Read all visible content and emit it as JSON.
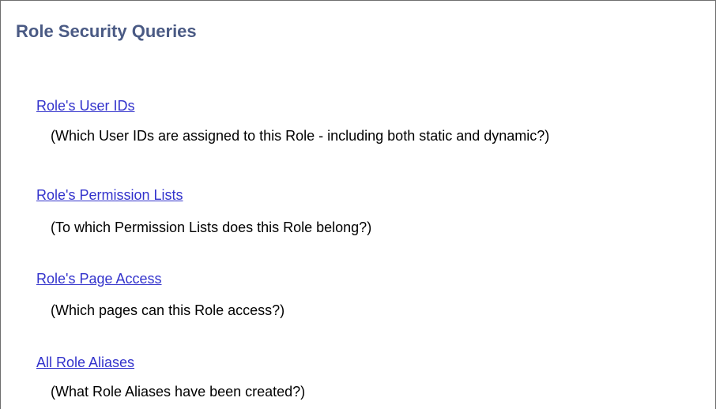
{
  "page": {
    "title": "Role Security Queries"
  },
  "queries": [
    {
      "link": "Role's User IDs",
      "description": "(Which User IDs are assigned to this Role - including both static and dynamic?)"
    },
    {
      "link": "Role's Permission Lists",
      "description": "(To which Permission Lists does this Role belong?)"
    },
    {
      "link": "Role's Page Access",
      "description": "(Which pages can this Role access?)"
    },
    {
      "link": "All Role Aliases",
      "description": "(What Role Aliases have been created?)"
    }
  ],
  "colors": {
    "title": "#4a5a84",
    "link": "#3333cc",
    "text": "#000000",
    "border": "#6e6e6e"
  }
}
